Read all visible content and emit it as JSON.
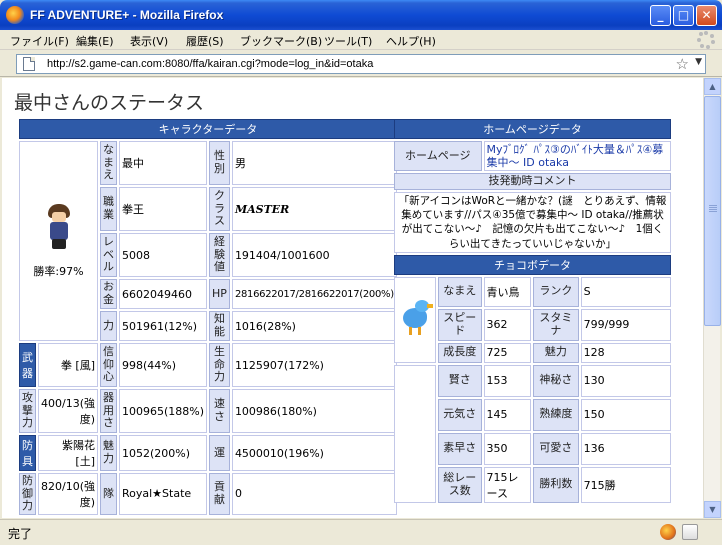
{
  "window": {
    "title": "FF ADVENTURE+ - Mozilla Firefox",
    "min": "_",
    "max": "□",
    "close": "✕"
  },
  "menu": [
    "ファイル(F)",
    "編集(E)",
    "表示(V)",
    "履歴(S)",
    "ブックマーク(B)",
    "ツール(T)",
    "ヘルプ(H)"
  ],
  "nav": {
    "url": "http://s2.game-can.com:8080/ffa/kairan.cgi?mode=log_in&id=otaka"
  },
  "page": {
    "title": "最中さんのステータス"
  },
  "character": {
    "header": "キャラクターデータ",
    "win_rate": "勝率:97%",
    "rows": [
      {
        "l1": "なまえ",
        "v1": "最中",
        "l2": "性別",
        "v2": "男"
      },
      {
        "l1": "職業",
        "v1": "拳王",
        "l2": "クラス",
        "v2": "MASTER"
      },
      {
        "l1": "レベル",
        "v1": "5008",
        "l2": "経験値",
        "v2": "191404/1001600"
      },
      {
        "l1": "お金",
        "v1": "6602049460",
        "l2": "HP",
        "v2": "2816622017/2816622017(200%)"
      },
      {
        "l1": "力",
        "v1": "501961(12%)",
        "l2": "知能",
        "v2": "1016(28%)"
      }
    ],
    "equip_rows": [
      {
        "k": "武器",
        "kv": "拳 [風]",
        "l1": "信仰心",
        "v1": "998(44%)",
        "l2": "生命力",
        "v2": "1125907(172%)"
      },
      {
        "k": "攻撃力",
        "kv": "400/13(強度)",
        "l1": "器用さ",
        "v1": "100965(188%)",
        "l2": "速さ",
        "v2": "100986(180%)"
      },
      {
        "k": "防具",
        "kv": "紫陽花 [土]",
        "l1": "魅力",
        "v1": "1052(200%)",
        "l2": "運",
        "v2": "4500010(196%)"
      },
      {
        "k": "防御力",
        "kv": "820/10(強度)",
        "l1": "隊",
        "v1": "Royal★State",
        "l2": "貢献",
        "v2": "0"
      }
    ]
  },
  "homepage": {
    "header": "ホームページデータ",
    "label": "ホームページ",
    "link": "Myﾌﾞﾛｸﾞ ﾊﾟｽ③のﾊﾞｲﾄ大量＆ﾊﾟｽ④募集中～ ID otaka",
    "comment_header": "技発動時コメント",
    "comment": "「新アイコンはWoRと一緒かな？(謎　とりあえず、情報集めています//パス④35億で募集中～ ID otaka//推薦状が出てこない～♪　記憶の欠片も出てこない～♪　1個くらい出てきたっていいじゃないか」"
  },
  "chocobo": {
    "header": "チョコボデータ",
    "rows": [
      {
        "l1": "なまえ",
        "v1": "青い鳥",
        "l2": "ランク",
        "v2": "S"
      },
      {
        "l1": "スピード",
        "v1": "362",
        "l2": "スタミナ",
        "v2": "799/999"
      },
      {
        "l1": "成長度",
        "v1": "725",
        "l2": "魅力",
        "v2": "128"
      },
      {
        "l1": "賢さ",
        "v1": "153",
        "l2": "神秘さ",
        "v2": "130"
      },
      {
        "l1": "元気さ",
        "v1": "145",
        "l2": "熟練度",
        "v2": "150"
      },
      {
        "l1": "素早さ",
        "v1": "350",
        "l2": "可愛さ",
        "v2": "136"
      },
      {
        "l1": "総レース数",
        "v1": "715レース",
        "l2": "勝利数",
        "v2": "715勝"
      }
    ]
  },
  "status": {
    "text": "完了"
  }
}
